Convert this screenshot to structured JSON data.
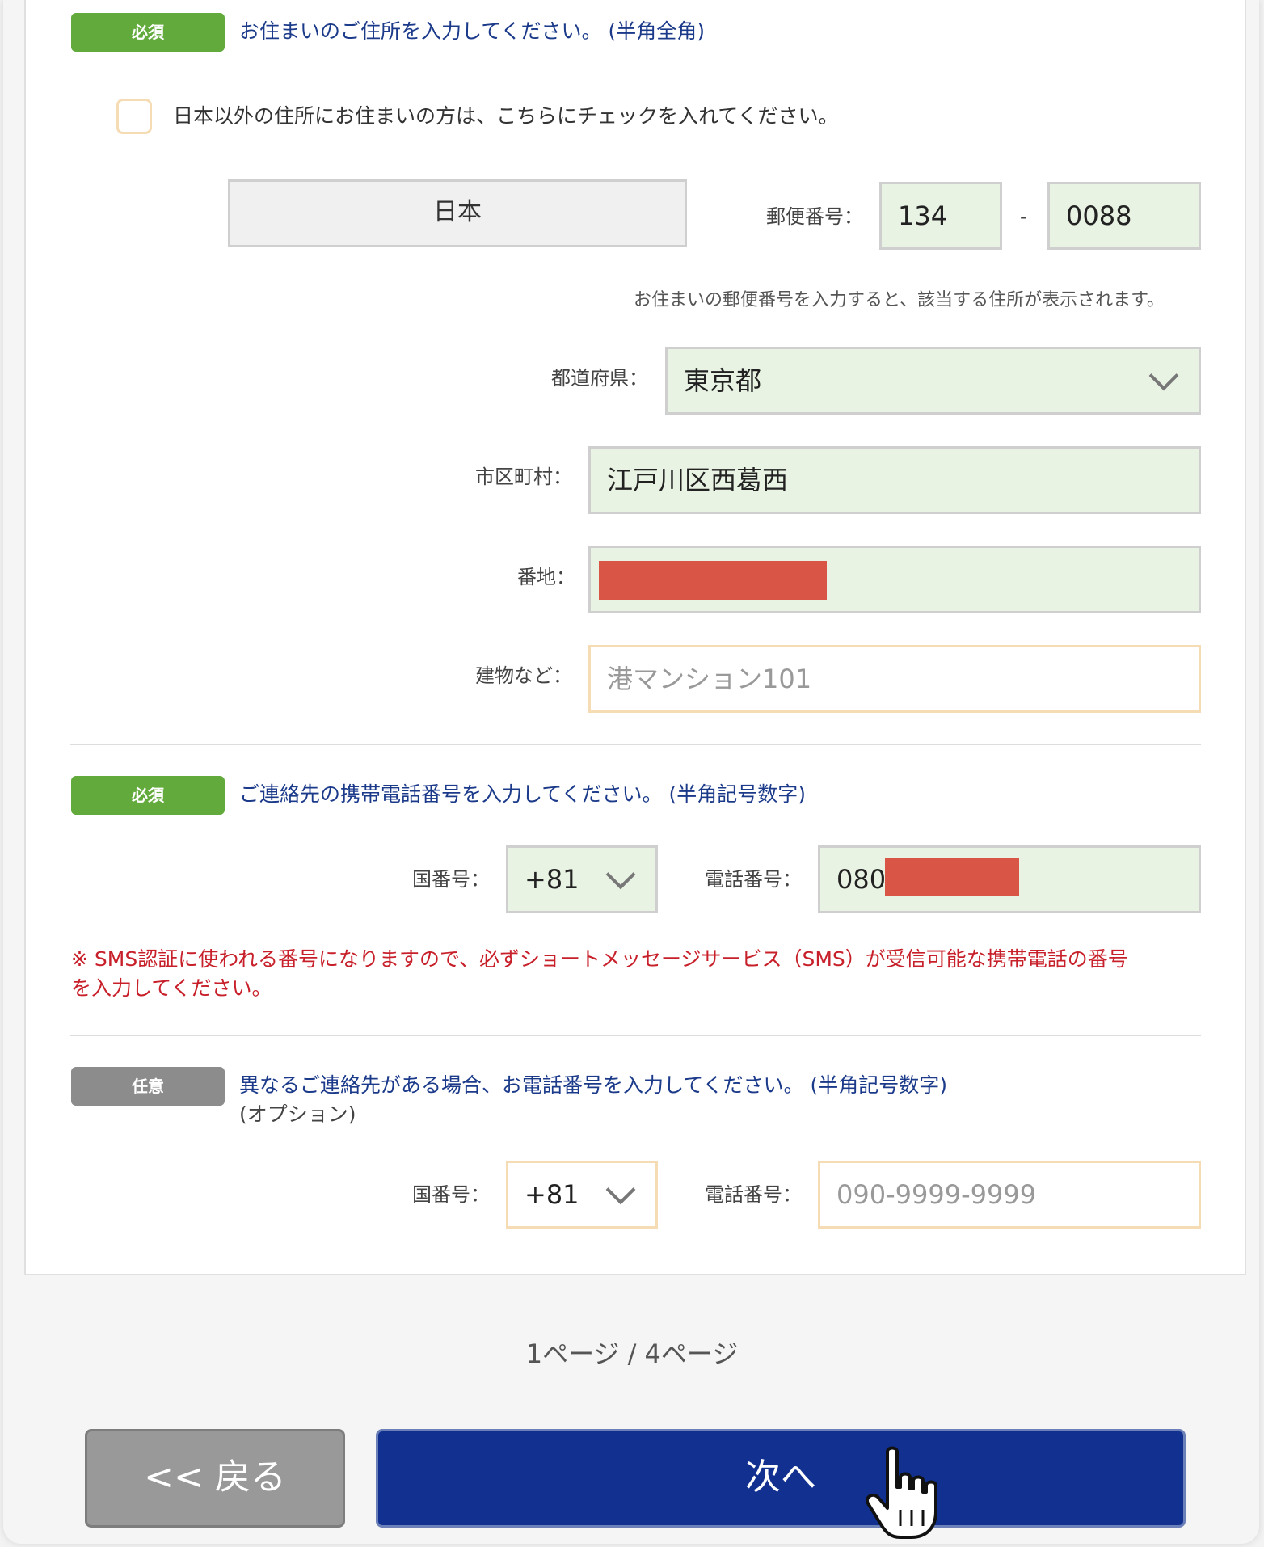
{
  "address": {
    "badge": "必須",
    "instruction": "お住まいのご住所を入力してください。 (半角全角)",
    "overseas_checkbox_label": "日本以外の住所にお住まいの方は、こちらにチェックを入れてください。",
    "country": "日本",
    "postal_label": "郵便番号：",
    "postal_part1": "134",
    "postal_separator": "-",
    "postal_part2": "0088",
    "postal_hint": "お住まいの郵便番号を入力すると、該当する住所が表示されます。",
    "prefecture_label": "都道府県：",
    "prefecture_value": "東京都",
    "city_label": "市区町村：",
    "city_value": "江戸川区西葛西",
    "street_label": "番地：",
    "building_label": "建物など：",
    "building_placeholder": "港マンション101"
  },
  "mobile": {
    "badge": "必須",
    "instruction": "ご連絡先の携帯電話番号を入力してください。 (半角記号数字)",
    "country_code_label": "国番号：",
    "country_code_value": "+81",
    "phone_label": "電話番号：",
    "phone_value": "080",
    "sms_note_line1": "※ SMS認証に使われる番号になりますので、必ずショートメッセージサービス（SMS）が受信可能な携帯電話の番号",
    "sms_note_line2": "を入力してください。"
  },
  "alt_phone": {
    "badge": "任意",
    "instruction_line1": "異なるご連絡先がある場合、お電話番号を入力してください。 (半角記号数字)",
    "instruction_line2": "(オプション)",
    "country_code_label": "国番号：",
    "country_code_value": "+81",
    "phone_label": "電話番号：",
    "phone_placeholder": "090-9999-9999"
  },
  "pagination": {
    "text": "1ページ / 4ページ"
  },
  "buttons": {
    "back": "<< 戻る",
    "next": "次へ"
  },
  "colors": {
    "required_badge": "#62aa3c",
    "optional_badge": "#8c8c8c",
    "instruction_text": "#1b3a8a",
    "filled_field_bg": "#e8f3e3",
    "empty_field_border": "#f6dcb4",
    "warning_text": "#c8202a",
    "next_button": "#11308f",
    "back_button": "#999999"
  }
}
